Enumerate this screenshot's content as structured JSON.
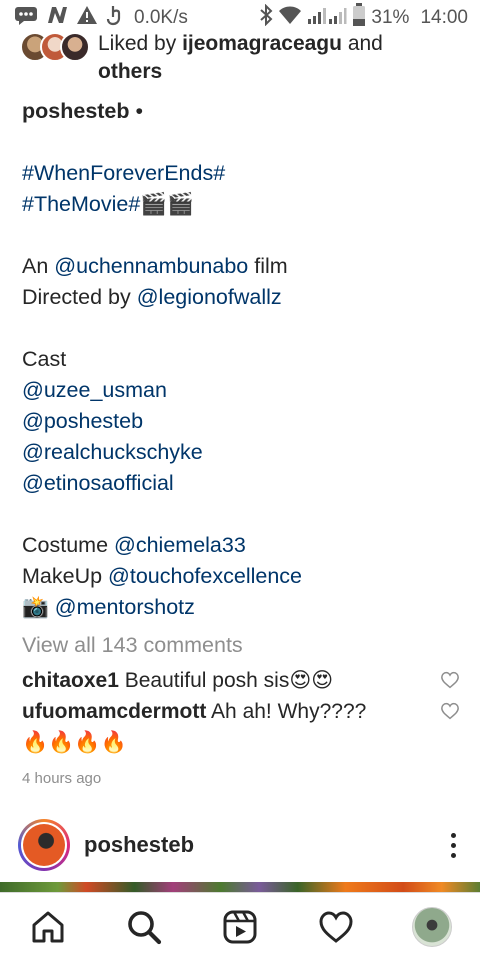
{
  "status_bar": {
    "speed": "0.0K/s",
    "battery": "31%",
    "time": "14:00"
  },
  "likes": {
    "prefix": "Liked by",
    "user": "ijeomagraceagu",
    "conjunction": "and",
    "others": "others"
  },
  "caption": {
    "username": "poshesteb",
    "dot": " •",
    "hashtag1": "#WhenForeverEnds#",
    "hashtag2": "#TheMovie#",
    "hashtag2_emoji": "🎬🎬",
    "film_prefix": "An ",
    "film_link": "@uchennambunabo",
    "film_suffix": " film",
    "directed_prefix": "Directed by ",
    "directed_link": "@legionofwallz",
    "cast_heading": "Cast",
    "cast": [
      "@uzee_usman",
      "@poshesteb",
      "@realchuckschyke",
      "@etinosaofficial"
    ],
    "costume_prefix": "Costume ",
    "costume_link": "@chiemela33",
    "makeup_prefix": "MakeUp ",
    "makeup_link": "@touchofexcellence",
    "camera_emoji": "📸 ",
    "camera_link": "@mentorshotz"
  },
  "view_all_comments": "View all 143 comments",
  "comments": [
    {
      "user": "chitaoxe1",
      "text": "Beautiful posh sis😍😍"
    },
    {
      "user": "ufuomamcdermott",
      "text": "Ah ah! Why????",
      "text2": "🔥🔥🔥🔥"
    }
  ],
  "time_ago": "4 hours ago",
  "next_post": {
    "username": "poshesteb"
  },
  "icons": {
    "status": [
      "message-icon",
      "n-icon",
      "warning-icon",
      "data-saver-icon",
      "bluetooth-icon",
      "wifi-icon",
      "signal-icon",
      "battery-icon"
    ],
    "nav": [
      "home-icon",
      "search-icon",
      "reels-icon",
      "heart-icon",
      "profile-icon"
    ]
  }
}
